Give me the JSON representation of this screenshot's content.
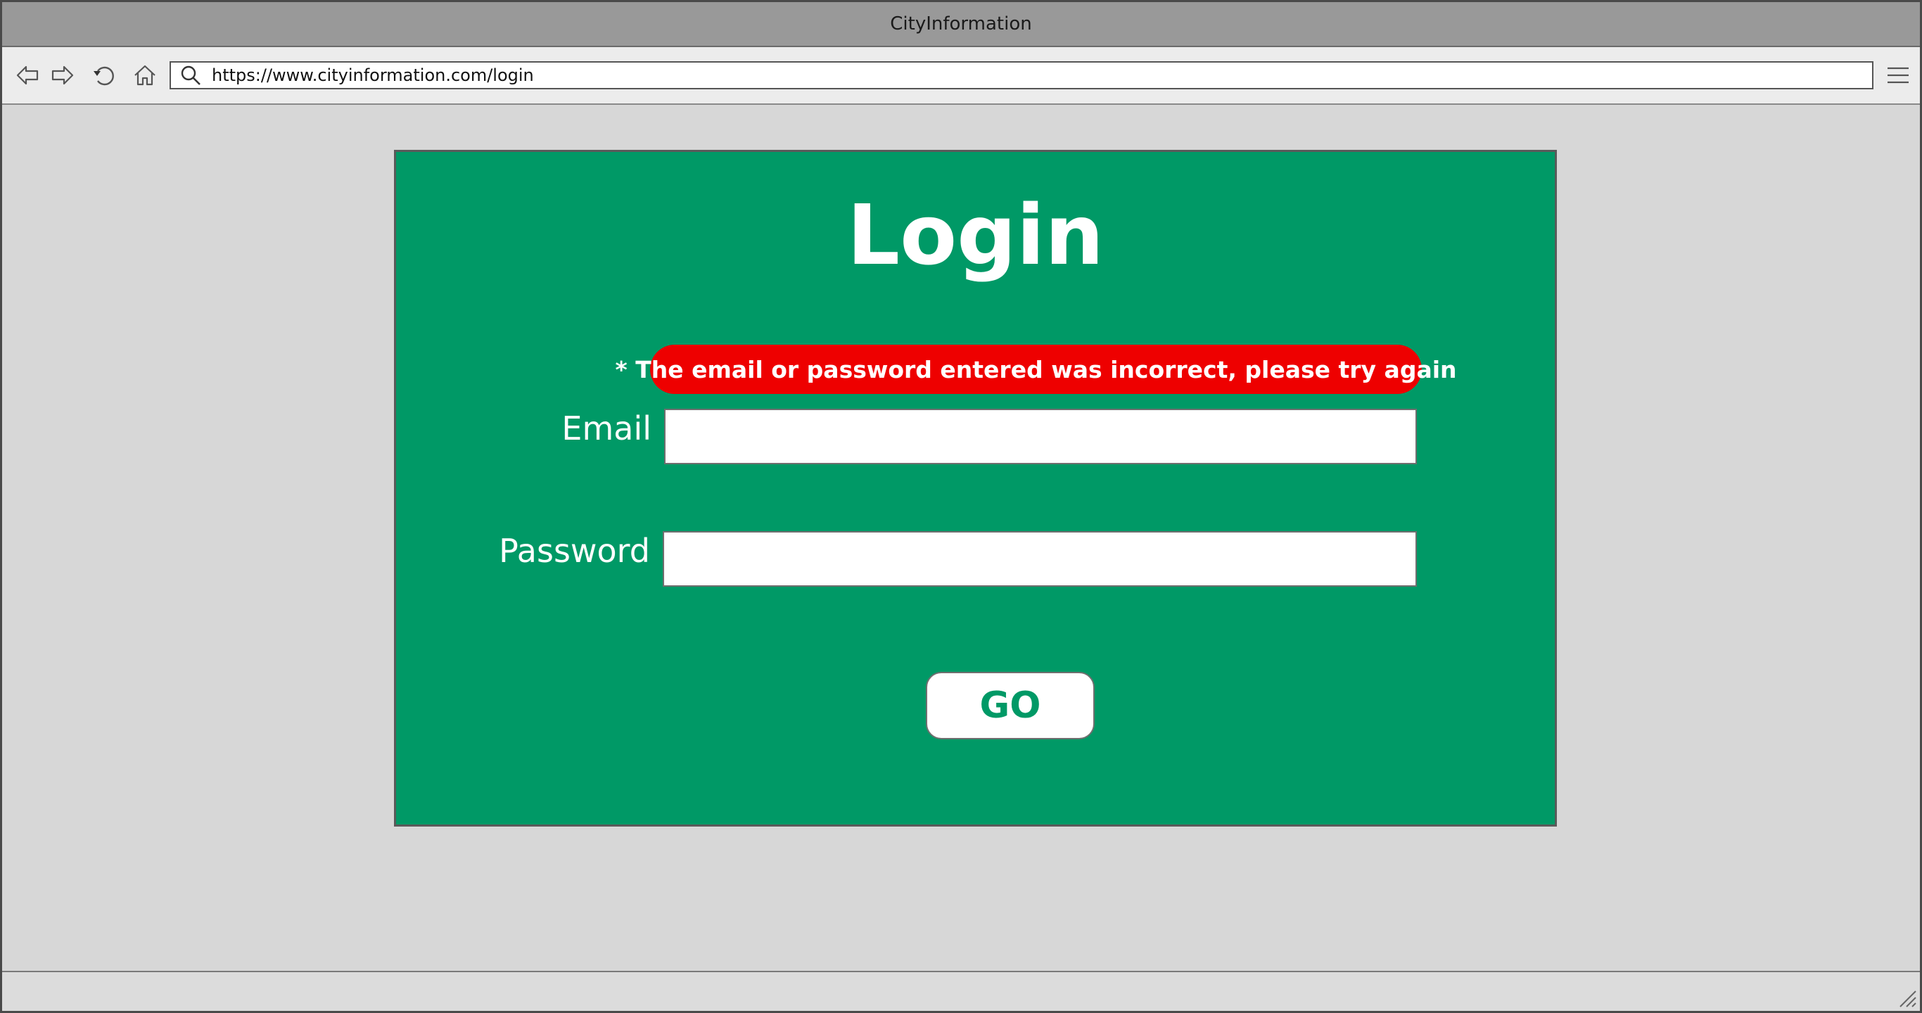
{
  "window": {
    "title": "CityInformation"
  },
  "toolbar": {
    "url": "https://www.cityinformation.com/login",
    "back_icon": "back-arrow-icon",
    "forward_icon": "forward-arrow-icon",
    "reload_icon": "reload-icon",
    "home_icon": "home-icon",
    "search_icon": "search-icon",
    "menu_icon": "hamburger-menu-icon"
  },
  "login": {
    "title": "Login",
    "error_message": "* The email or password entered was incorrect, please try again",
    "email_label": "Email",
    "email_value": "",
    "password_label": "Password",
    "password_value": "",
    "submit_label": "GO"
  },
  "colors": {
    "panel_background": "#009966",
    "error_background": "#ee0000",
    "title_bar": "#999999",
    "page_background": "#d7d7d7"
  }
}
